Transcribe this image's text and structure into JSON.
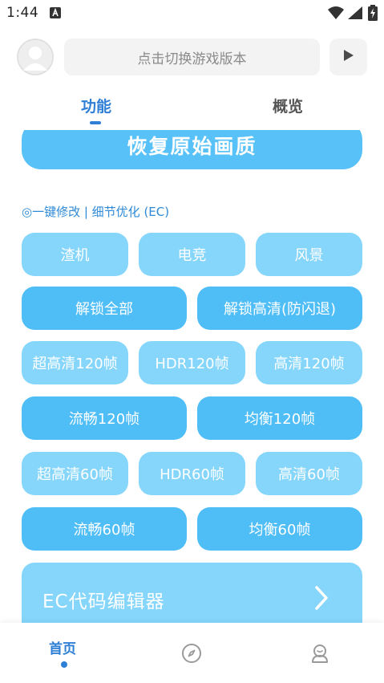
{
  "status_bar": {
    "time": "1:44",
    "notification_icon": "a-letter-notification-icon",
    "wifi_icon": "wifi-icon",
    "signal_icon": "cell-signal-icon",
    "battery_icon": "battery-charging-icon"
  },
  "header": {
    "avatar_icon": "user-avatar-icon",
    "search_placeholder": "点击切换游戏版本",
    "play_icon": "play-icon"
  },
  "tabs": [
    {
      "label": "功能",
      "active": true
    },
    {
      "label": "概览",
      "active": false
    }
  ],
  "main": {
    "restore_button": "恢复原始画质",
    "section_title": "◎一键修改 | 细节优化 (EC)",
    "buttons": [
      {
        "label": "渣机",
        "style": "light"
      },
      {
        "label": "电竞",
        "style": "light"
      },
      {
        "label": "风景",
        "style": "light"
      },
      {
        "label": "解锁全部",
        "style": "dark"
      },
      {
        "label": "解锁高清(防闪退)",
        "style": "dark"
      },
      {
        "label": "超高清120帧",
        "style": "light"
      },
      {
        "label": "HDR120帧",
        "style": "light"
      },
      {
        "label": "高清120帧",
        "style": "light"
      },
      {
        "label": "流畅120帧",
        "style": "dark"
      },
      {
        "label": "均衡120帧",
        "style": "dark"
      },
      {
        "label": "超高清60帧",
        "style": "light"
      },
      {
        "label": "HDR60帧",
        "style": "light"
      },
      {
        "label": "高清60帧",
        "style": "light"
      },
      {
        "label": "流畅60帧",
        "style": "dark"
      },
      {
        "label": "均衡60帧",
        "style": "dark"
      }
    ],
    "editor_card": {
      "label": "EC代码编辑器",
      "chevron_icon": "chevron-right-icon"
    }
  },
  "bottom_nav": {
    "home_label": "首页",
    "explore_icon": "compass-icon",
    "profile_icon": "profile-icon"
  },
  "colors": {
    "accent": "#2f7fd6",
    "button_light": "#86d6fb",
    "button_dark": "#4fbdf6",
    "restore_button": "#58c1f7",
    "section_title": "#2f8ad6"
  }
}
